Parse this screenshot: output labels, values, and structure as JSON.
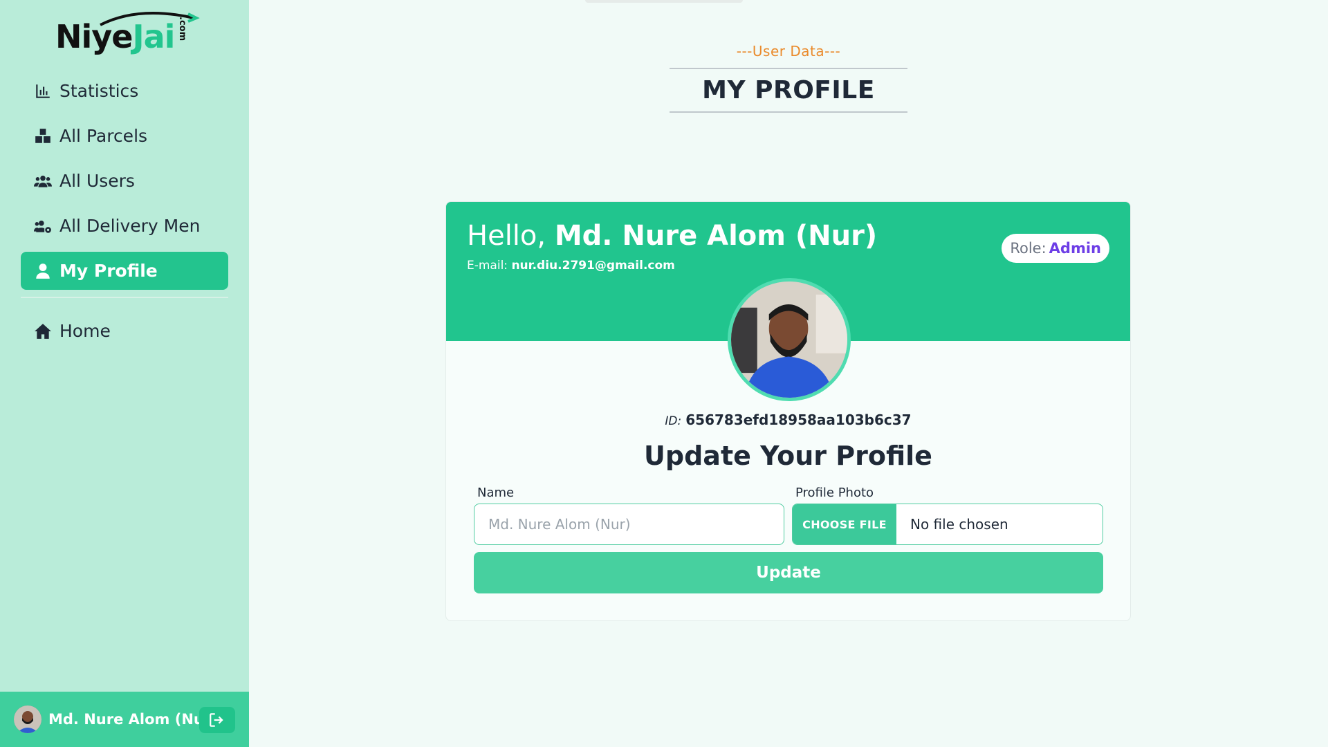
{
  "brand": {
    "name_part1": "Niye",
    "name_part2": "Jai",
    "tld": ".com"
  },
  "sidebar": {
    "items": [
      {
        "label": "Statistics",
        "icon": "bar-chart-icon"
      },
      {
        "label": "All Parcels",
        "icon": "boxes-icon"
      },
      {
        "label": "All Users",
        "icon": "users-icon"
      },
      {
        "label": "All Delivery Men",
        "icon": "users-gear-icon"
      },
      {
        "label": "My Profile",
        "icon": "user-icon",
        "active": true
      }
    ],
    "secondary": [
      {
        "label": "Home",
        "icon": "home-icon"
      }
    ],
    "footer": {
      "user_name": "Md. Nure Alom (Nur)",
      "logout_icon": "logout-icon"
    }
  },
  "header": {
    "subtitle": "---User Data---",
    "title": "MY PROFILE"
  },
  "profile": {
    "greeting": "Hello,",
    "name": "Md. Nure Alom (Nur)",
    "email_label": "E-mail:",
    "email": "nur.diu.2791@gmail.com",
    "role_label": "Role:",
    "role": "Admin",
    "id_label": "ID:",
    "id": "656783efd18958aa103b6c37"
  },
  "form": {
    "title": "Update Your Profile",
    "name_label": "Name",
    "name_placeholder": "Md. Nure Alom (Nur)",
    "photo_label": "Profile Photo",
    "choose_file": "CHOOSE FILE",
    "no_file": "No file chosen",
    "submit": "Update"
  },
  "colors": {
    "accent": "#21c58e",
    "sidebar_bg": "#b9ecd9",
    "role": "#6d3ee6",
    "subtitle": "#ea8a2b"
  }
}
